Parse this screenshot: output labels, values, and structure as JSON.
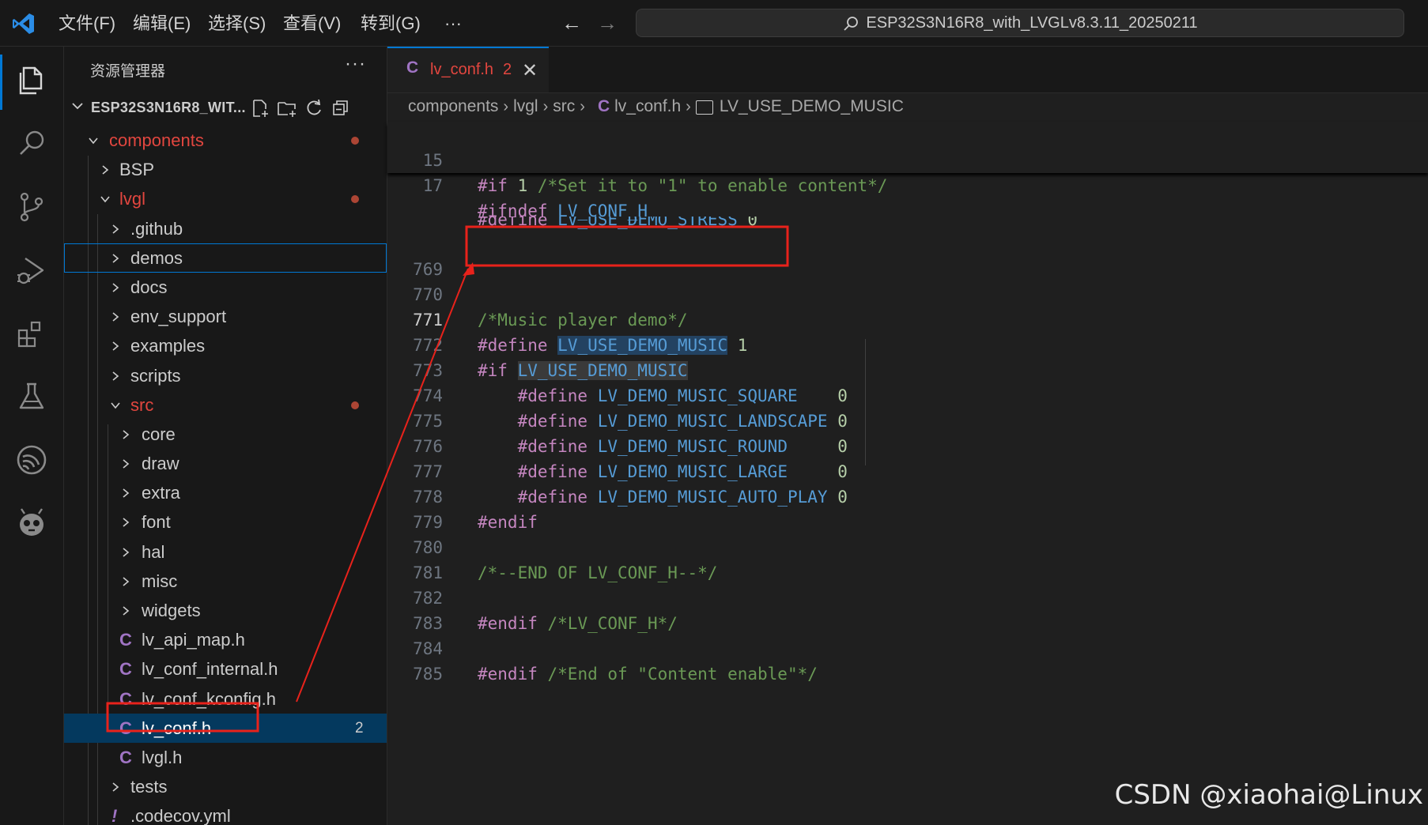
{
  "titlebar": {
    "menus": [
      "文件(F)",
      "编辑(E)",
      "选择(S)",
      "查看(V)",
      "转到(G)",
      "···"
    ],
    "search": "ESP32S3N16R8_with_LVGLv8.3.11_20250211"
  },
  "activitybar": {
    "icons": [
      "explorer-icon",
      "search-icon",
      "source-control-icon",
      "run-debug-icon",
      "extensions-icon",
      "testing-icon",
      "espressif-icon",
      "platformio-icon"
    ]
  },
  "explorer": {
    "title": "资源管理器",
    "more": "···",
    "workspace": "ESP32S3N16R8_WIT...",
    "items": [
      {
        "label": "components",
        "state": "open"
      },
      {
        "label": "BSP",
        "state": "closed"
      },
      {
        "label": "lvgl",
        "state": "open"
      },
      {
        "label": ".github",
        "state": "closed"
      },
      {
        "label": "demos",
        "state": "closed"
      },
      {
        "label": "docs",
        "state": "closed"
      },
      {
        "label": "env_support",
        "state": "closed"
      },
      {
        "label": "examples",
        "state": "closed"
      },
      {
        "label": "scripts",
        "state": "closed"
      },
      {
        "label": "src",
        "state": "open"
      },
      {
        "label": "core",
        "state": "closed"
      },
      {
        "label": "draw",
        "state": "closed"
      },
      {
        "label": "extra",
        "state": "closed"
      },
      {
        "label": "font",
        "state": "closed"
      },
      {
        "label": "hal",
        "state": "closed"
      },
      {
        "label": "misc",
        "state": "closed"
      },
      {
        "label": "widgets",
        "state": "closed"
      },
      {
        "label": "lv_api_map.h",
        "state": "file",
        "icon": "C"
      },
      {
        "label": "lv_conf_internal.h",
        "state": "file",
        "icon": "C"
      },
      {
        "label": "lv_conf_kconfig.h",
        "state": "file",
        "icon": "C"
      },
      {
        "label": "lv_conf.h",
        "state": "file",
        "icon": "C",
        "badge": "2"
      },
      {
        "label": "lvgl.h",
        "state": "file",
        "icon": "C"
      },
      {
        "label": "tests",
        "state": "closed"
      },
      {
        "label": ".codecov.yml",
        "state": "file",
        "icon": "!"
      }
    ]
  },
  "editor": {
    "tab": {
      "icon": "C",
      "label": "lv_conf.h",
      "count": "2",
      "close": "✕"
    },
    "breadcrumb": [
      "components",
      "lvgl",
      "src",
      "lv_conf.h",
      "LV_USE_DEMO_MUSIC"
    ],
    "breadcrumb_file_icon": "C",
    "sticky": [
      {
        "n": "15",
        "code": "#if 1 /*Set it to \"1\" to enable content*/"
      },
      {
        "n": "17",
        "code": "#ifndef LV_CONF_H"
      }
    ],
    "lines": [
      {
        "n": "769",
        "code": ""
      },
      {
        "n": "770",
        "code": "/*Music player demo*/"
      },
      {
        "n": "771",
        "code": "#define LV_USE_DEMO_MUSIC 1"
      },
      {
        "n": "772",
        "code": "#if LV_USE_DEMO_MUSIC"
      },
      {
        "n": "773",
        "code": "    #define LV_DEMO_MUSIC_SQUARE    0"
      },
      {
        "n": "774",
        "code": "    #define LV_DEMO_MUSIC_LANDSCAPE 0"
      },
      {
        "n": "775",
        "code": "    #define LV_DEMO_MUSIC_ROUND     0"
      },
      {
        "n": "776",
        "code": "    #define LV_DEMO_MUSIC_LARGE     0"
      },
      {
        "n": "777",
        "code": "    #define LV_DEMO_MUSIC_AUTO_PLAY 0"
      },
      {
        "n": "778",
        "code": "#endif"
      },
      {
        "n": "779",
        "code": ""
      },
      {
        "n": "780",
        "code": "/*--END OF LV_CONF_H--*/"
      },
      {
        "n": "781",
        "code": ""
      },
      {
        "n": "782",
        "code": "#endif /*LV_CONF_H*/"
      },
      {
        "n": "783",
        "code": ""
      },
      {
        "n": "784",
        "code": "#endif /*End of \"Content enable\"*/"
      },
      {
        "n": "785",
        "code": ""
      }
    ]
  },
  "watermark": "CSDN @xiaohai@Linux",
  "colors": {
    "accent": "#0078d4",
    "annotation": "#e8221b",
    "modified": "#e2463f"
  }
}
